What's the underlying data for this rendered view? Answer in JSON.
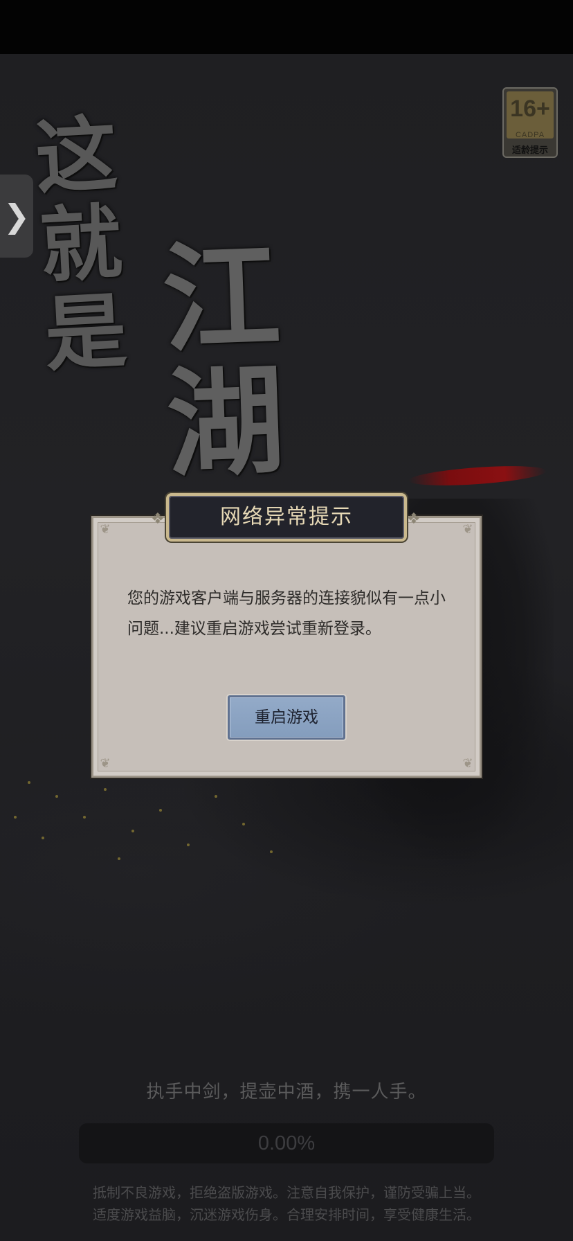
{
  "game": {
    "calligraphy_line1": "这就是",
    "calligraphy_line2": "江湖"
  },
  "age_rating": {
    "number": "16+",
    "org": "CADPA",
    "label": "适龄提示"
  },
  "side_tab": {
    "icon": "chevron-right-icon",
    "glyph": "❯"
  },
  "dialog": {
    "title": "网络异常提示",
    "message": "您的游戏客户端与服务器的连接貌似有一点小问题...建议重启游戏尝试重新登录。",
    "button_label": "重启游戏"
  },
  "slogan": "执手中剑，提壶中酒，携一人手。",
  "progress": {
    "value": 0.0,
    "text": "0.00%"
  },
  "health_notice": {
    "line1": "抵制不良游戏，拒绝盗版游戏。注意自我保护，谨防受骗上当。",
    "line2": "适度游戏益脑，沉迷游戏伤身。合理安排时间，享受健康生活。"
  },
  "colors": {
    "background": "#1e1e20",
    "dialog_bg": "#c6bfb9",
    "title_plate": "#22232b",
    "title_gold": "#e7d9b6",
    "button_blue": "#8da4c4"
  }
}
